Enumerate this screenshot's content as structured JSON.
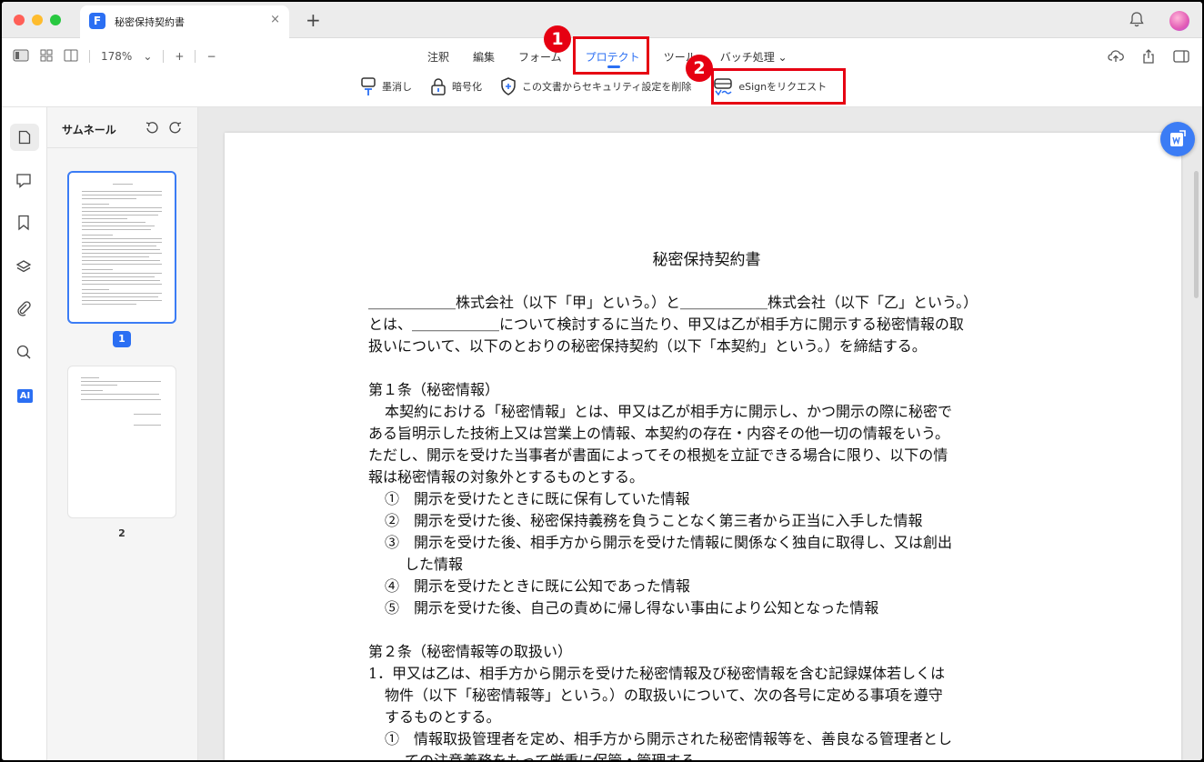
{
  "window": {
    "tab_title": "秘密保持契約書",
    "tab_close": "×",
    "tab_add": "+",
    "logo_letter": "F"
  },
  "toolbar": {
    "zoom": "178%",
    "zoom_dropdown": "⌄",
    "zoom_in": "+",
    "zoom_out": "−",
    "menu": [
      "注釈",
      "編集",
      "フォーム",
      "プロテクト",
      "ツール",
      "バッチ処理"
    ],
    "menu_active_index": 3,
    "batch_chevron": "⌄",
    "subtools": {
      "redact": "墨消し",
      "encrypt": "暗号化",
      "remove_security": "この文書からセキュリティ設定を削除",
      "esign": "eSignをリクエスト"
    }
  },
  "annotations": {
    "badge1": "1",
    "badge2": "2",
    "highlight_color": "#e60012"
  },
  "sidebar": {
    "rail_icons": [
      "page-icon",
      "comment-icon",
      "bookmark-icon",
      "layers-icon",
      "attachment-icon",
      "search-icon",
      "ai-icon"
    ],
    "ai_label": "AI",
    "panel_title": "サムネール",
    "pages": [
      "1",
      "2"
    ],
    "selected_page": "1"
  },
  "document": {
    "title": "秘密保持契約書",
    "lines": [
      "＿＿＿＿＿＿株式会社（以下「甲」という。）と＿＿＿＿＿＿株式会社（以下「乙」という。）",
      "とは、＿＿＿＿＿＿について検討するに当たり、甲又は乙が相手方に開示する秘密情報の取",
      "扱いについて、以下のとおりの秘密保持契約（以下「本契約」という。）を締結する。",
      "第１条（秘密情報）",
      "本契約における「秘密情報」とは、甲又は乙が相手方に開示し、かつ開示の際に秘密で",
      "ある旨明示した技術上又は営業上の情報、本契約の存在・内容その他一切の情報をいう。",
      "ただし、開示を受けた当事者が書面によってその根拠を立証できる場合に限り、以下の情",
      "報は秘密情報の対象外とするものとする。",
      "①　開示を受けたときに既に保有していた情報",
      "②　開示を受けた後、秘密保持義務を負うことなく第三者から正当に入手した情報",
      "③　開示を受けた後、相手方から開示を受けた情報に関係なく独自に取得し、又は創出",
      "した情報",
      "④　開示を受けたときに既に公知であった情報",
      "⑤　開示を受けた後、自己の責めに帰し得ない事由により公知となった情報",
      "第２条（秘密情報等の取扱い）",
      "1．甲又は乙は、相手方から開示を受けた秘密情報及び秘密情報を含む記録媒体若しくは",
      "物件（以下「秘密情報等」という。）の取扱いについて、次の各号に定める事項を遵守",
      "するものとする。",
      "①　情報取扱管理者を定め、相手方から開示された秘密情報等を、善良なる管理者とし",
      "ての注意義務をもって厳重に保管・管理する。"
    ]
  },
  "colors": {
    "accent": "#2b6ff3",
    "highlight": "#e60012"
  }
}
